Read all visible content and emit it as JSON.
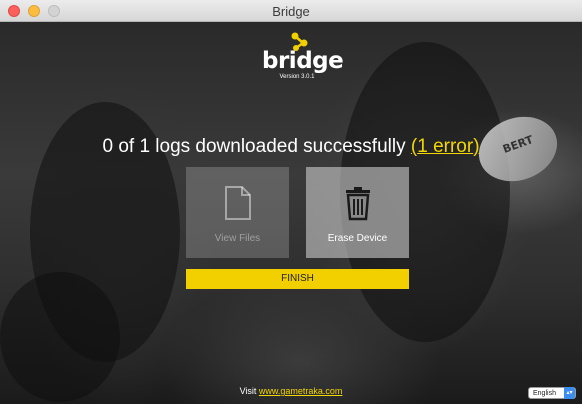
{
  "window": {
    "title": "Bridge"
  },
  "logo": {
    "word": "bridge",
    "version": "Version 3.0.1"
  },
  "status": {
    "prefix": "0 of 1 logs downloaded successfully ",
    "open_paren": "(",
    "error_link": "1 error",
    "close_paren": ")"
  },
  "tiles": {
    "view_files": "View Files",
    "erase_device": "Erase Device"
  },
  "finish_button": "FINISH",
  "footer": {
    "visit": "Visit ",
    "link": "www.gametraka.com"
  },
  "language": {
    "selected": "English"
  },
  "ball_text": "BERT",
  "colors": {
    "accent": "#f2d000",
    "link": "#f4d600",
    "select": "#3b8df0"
  }
}
